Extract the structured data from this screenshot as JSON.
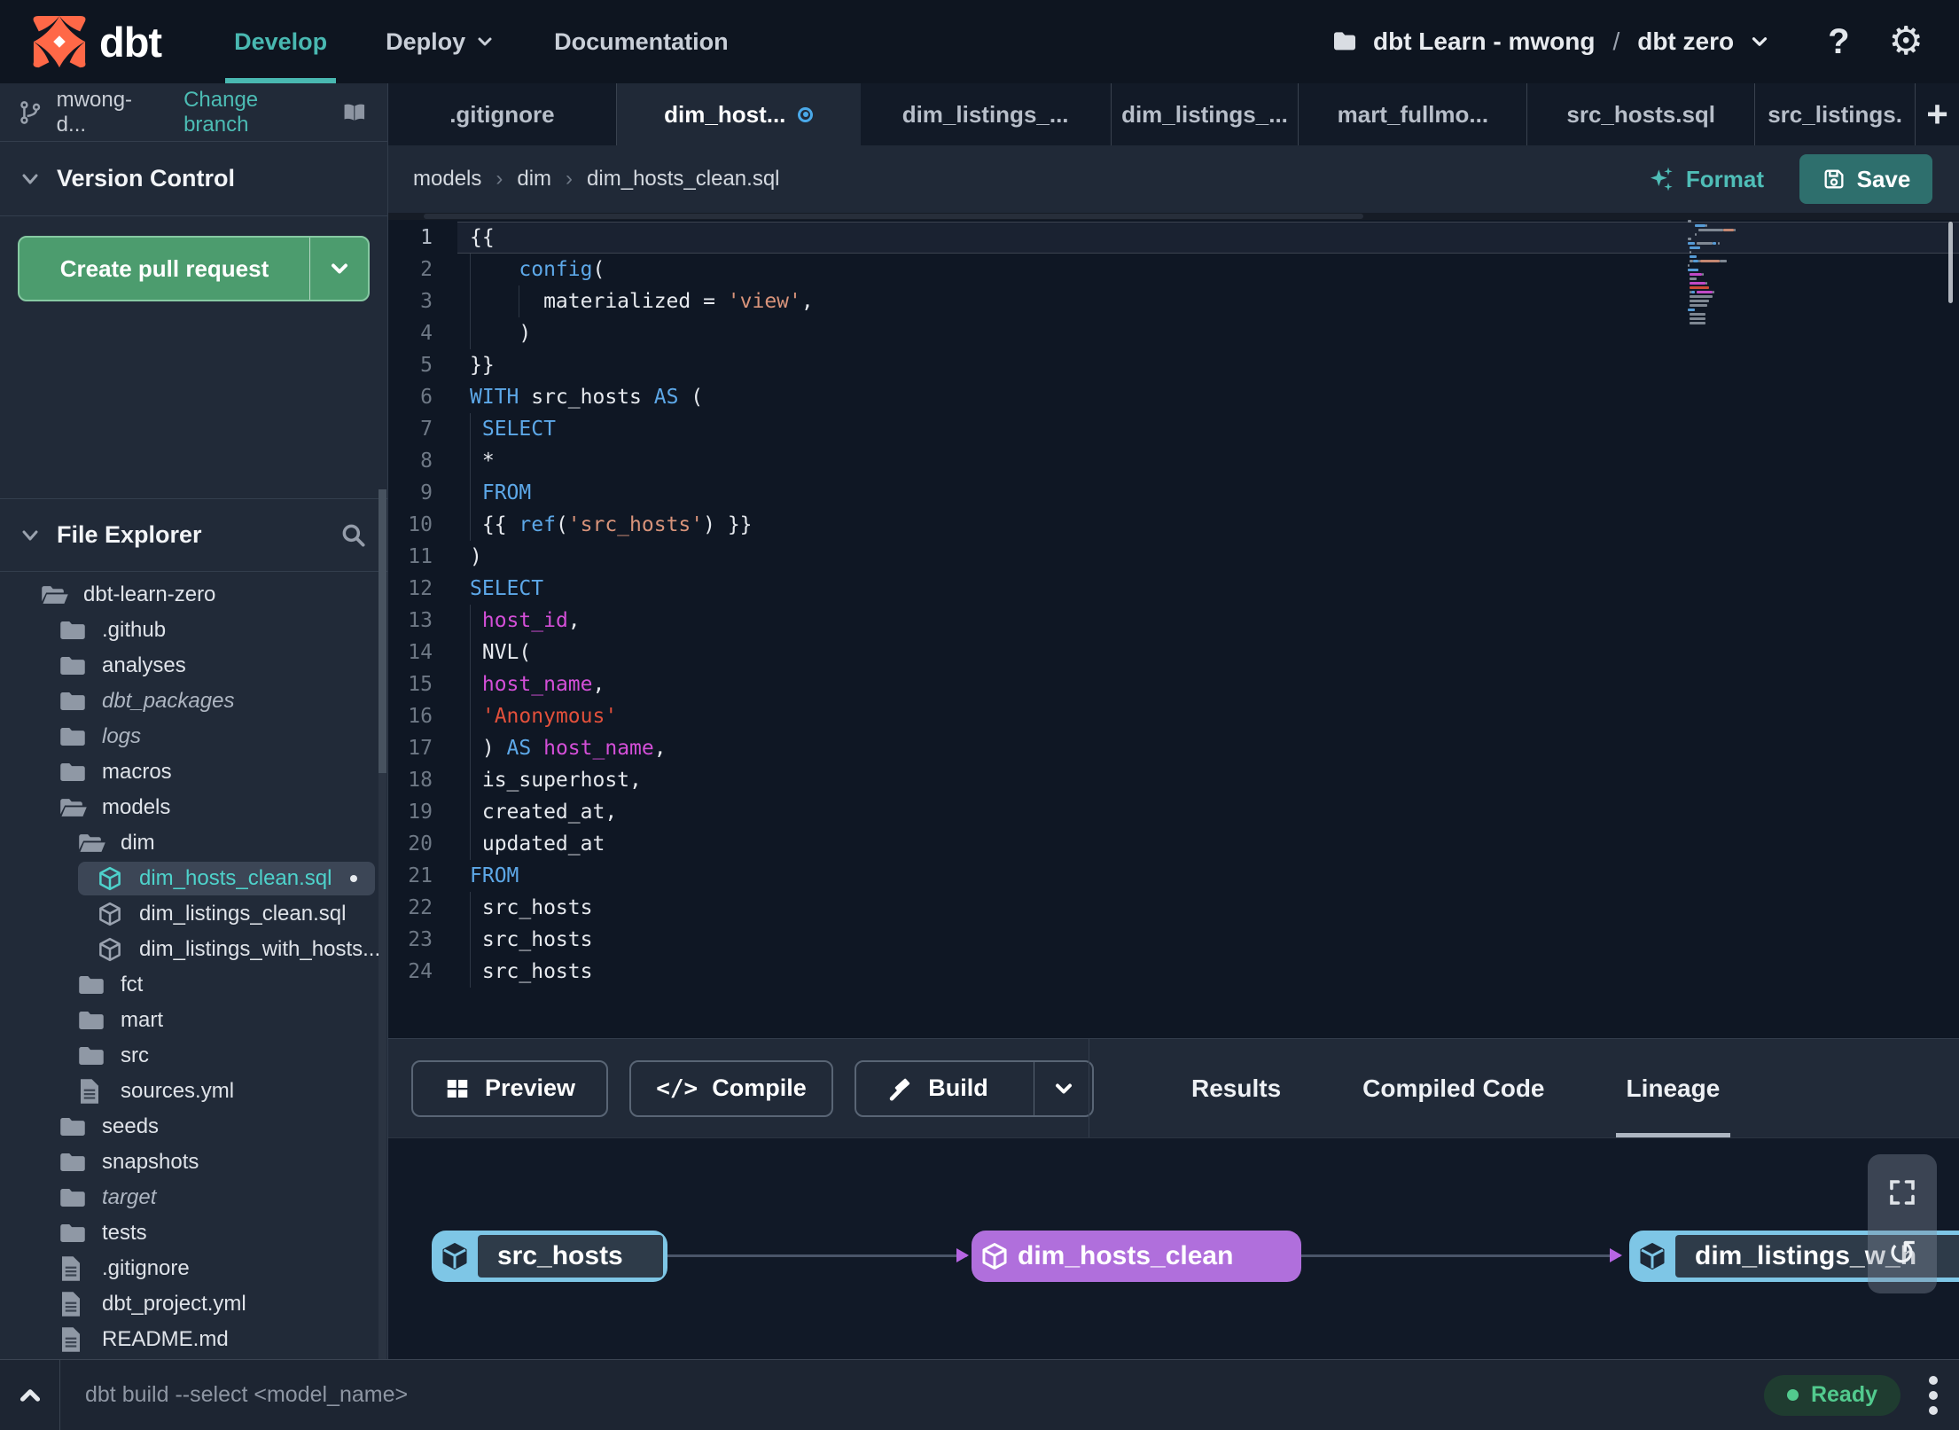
{
  "colors": {
    "accent_teal": "#49b8b1",
    "logo_orange": "#ff6847",
    "pr_green": "#4c9c6e",
    "save_teal": "#2e6f6d",
    "tab_modified_blue": "#4aa9e9",
    "lineage_blue": "#7ec6e6",
    "lineage_purple": "#b06fdc",
    "ready_green": "#52ca8e",
    "keyword_blue": "#5da8e8",
    "string_orange": "#d8937a",
    "string_red": "#e2503b",
    "ident_magenta": "#d44fd8"
  },
  "topbar": {
    "logo_text": "dbt",
    "nav": [
      {
        "label": "Develop"
      },
      {
        "label": "Deploy"
      },
      {
        "label": "Documentation"
      }
    ],
    "project": {
      "account": "dbt Learn - mwong",
      "separator": "/",
      "name": "dbt zero"
    }
  },
  "sidebar": {
    "branch": {
      "name": "mwong-d...",
      "change_link": "Change branch"
    },
    "version_control_title": "Version Control",
    "create_pr_label": "Create pull request",
    "file_explorer_title": "File Explorer",
    "tree": [
      {
        "label": "dbt-learn-zero",
        "type": "folder-open",
        "depth": 0
      },
      {
        "label": ".github",
        "type": "folder",
        "depth": 1
      },
      {
        "label": "analyses",
        "type": "folder",
        "depth": 1
      },
      {
        "label": "dbt_packages",
        "type": "folder",
        "depth": 1,
        "italic": true
      },
      {
        "label": "logs",
        "type": "folder",
        "depth": 1,
        "italic": true
      },
      {
        "label": "macros",
        "type": "folder",
        "depth": 1
      },
      {
        "label": "models",
        "type": "folder-open",
        "depth": 1
      },
      {
        "label": "dim",
        "type": "folder-open",
        "depth": 2
      },
      {
        "label": "dim_hosts_clean.sql",
        "type": "model",
        "depth": 3,
        "selected": true,
        "modified": true
      },
      {
        "label": "dim_listings_clean.sql",
        "type": "model",
        "depth": 3
      },
      {
        "label": "dim_listings_with_hosts...",
        "type": "model",
        "depth": 3
      },
      {
        "label": "fct",
        "type": "folder",
        "depth": 2
      },
      {
        "label": "mart",
        "type": "folder",
        "depth": 2
      },
      {
        "label": "src",
        "type": "folder",
        "depth": 2
      },
      {
        "label": "sources.yml",
        "type": "file",
        "depth": 2
      },
      {
        "label": "seeds",
        "type": "folder",
        "depth": 1
      },
      {
        "label": "snapshots",
        "type": "folder",
        "depth": 1
      },
      {
        "label": "target",
        "type": "folder",
        "depth": 1,
        "italic": true
      },
      {
        "label": "tests",
        "type": "folder",
        "depth": 1
      },
      {
        "label": ".gitignore",
        "type": "file",
        "depth": 1
      },
      {
        "label": "dbt_project.yml",
        "type": "file",
        "depth": 1
      },
      {
        "label": "README.md",
        "type": "file",
        "depth": 1
      }
    ]
  },
  "tabs": {
    "items": [
      {
        "label": ".gitignore"
      },
      {
        "label": "dim_host...",
        "active": true,
        "modified": true
      },
      {
        "label": "dim_listings_..."
      },
      {
        "label": "dim_listings_..."
      },
      {
        "label": "mart_fullmo..."
      },
      {
        "label": "src_hosts.sql"
      },
      {
        "label": "src_listings."
      }
    ],
    "add_button": "+"
  },
  "editorbar": {
    "breadcrumb": [
      "models",
      "dim",
      "dim_hosts_clean.sql"
    ],
    "format_label": "Format",
    "save_label": "Save"
  },
  "editor": {
    "lines": [
      {
        "n": 1,
        "cur": true,
        "t": [
          [
            "w",
            "{{"
          ]
        ]
      },
      {
        "n": 2,
        "g": [
          0
        ],
        "t": [
          [
            "w",
            "    "
          ],
          [
            "k",
            "config"
          ],
          [
            "w",
            "("
          ]
        ]
      },
      {
        "n": 3,
        "g": [
          0,
          4
        ],
        "t": [
          [
            "w",
            "      materialized = "
          ],
          [
            "s1",
            "'view'"
          ],
          [
            "w",
            ","
          ]
        ]
      },
      {
        "n": 4,
        "g": [
          0
        ],
        "t": [
          [
            "w",
            "    )"
          ]
        ]
      },
      {
        "n": 5,
        "t": [
          [
            "w",
            "}}"
          ]
        ]
      },
      {
        "n": 6,
        "t": [
          [
            "k",
            "WITH"
          ],
          [
            "w",
            " src_hosts "
          ],
          [
            "k",
            "AS"
          ],
          [
            "w",
            " ("
          ]
        ]
      },
      {
        "n": 7,
        "g": [
          0
        ],
        "t": [
          [
            "w",
            " "
          ],
          [
            "k",
            "SELECT"
          ]
        ]
      },
      {
        "n": 8,
        "g": [
          0
        ],
        "t": [
          [
            "w",
            " *"
          ]
        ]
      },
      {
        "n": 9,
        "g": [
          0
        ],
        "t": [
          [
            "w",
            " "
          ],
          [
            "k",
            "FROM"
          ]
        ]
      },
      {
        "n": 10,
        "g": [
          0
        ],
        "t": [
          [
            "w",
            " {{ "
          ],
          [
            "k",
            "ref"
          ],
          [
            "w",
            "("
          ],
          [
            "s1",
            "'src_hosts'"
          ],
          [
            "w",
            ") }}"
          ]
        ]
      },
      {
        "n": 11,
        "t": [
          [
            "w",
            ")"
          ]
        ]
      },
      {
        "n": 12,
        "t": [
          [
            "k",
            "SELECT"
          ]
        ]
      },
      {
        "n": 13,
        "g": [
          0
        ],
        "t": [
          [
            "w",
            " "
          ],
          [
            "m",
            "host_id"
          ],
          [
            "w",
            ","
          ]
        ]
      },
      {
        "n": 14,
        "g": [
          0
        ],
        "t": [
          [
            "w",
            " NVL("
          ]
        ]
      },
      {
        "n": 15,
        "g": [
          0
        ],
        "t": [
          [
            "w",
            " "
          ],
          [
            "m",
            "host_name"
          ],
          [
            "w",
            ","
          ]
        ]
      },
      {
        "n": 16,
        "g": [
          0
        ],
        "t": [
          [
            "w",
            " "
          ],
          [
            "s2",
            "'Anonymous'"
          ]
        ]
      },
      {
        "n": 17,
        "g": [
          0
        ],
        "t": [
          [
            "w",
            " ) "
          ],
          [
            "k",
            "AS"
          ],
          [
            "w",
            " "
          ],
          [
            "m",
            "host_name"
          ],
          [
            "w",
            ","
          ]
        ]
      },
      {
        "n": 18,
        "g": [
          0
        ],
        "t": [
          [
            "w",
            " is_superhost,"
          ]
        ]
      },
      {
        "n": 19,
        "g": [
          0
        ],
        "t": [
          [
            "w",
            " created_at,"
          ]
        ]
      },
      {
        "n": 20,
        "g": [
          0
        ],
        "t": [
          [
            "w",
            " updated_at"
          ]
        ]
      },
      {
        "n": 21,
        "t": [
          [
            "k",
            "FROM"
          ]
        ]
      },
      {
        "n": 22,
        "g": [
          0
        ],
        "t": [
          [
            "w",
            " src_hosts"
          ]
        ]
      },
      {
        "n": 23,
        "g": [
          0
        ],
        "t": [
          [
            "w",
            " src_hosts"
          ]
        ]
      },
      {
        "n": 24,
        "g": [
          0
        ],
        "t": [
          [
            "w",
            " src_hosts"
          ]
        ]
      }
    ]
  },
  "panel": {
    "preview_label": "Preview",
    "compile_label": "Compile",
    "compile_icon": "</>",
    "build_label": "Build",
    "tabs": [
      {
        "label": "Results"
      },
      {
        "label": "Compiled Code"
      },
      {
        "label": "Lineage",
        "active": true
      }
    ]
  },
  "lineage": {
    "nodes": [
      {
        "label": "src_hosts",
        "style": "blue"
      },
      {
        "label": "dim_hosts_clean",
        "style": "purple"
      },
      {
        "label": "dim_listings_w_h",
        "style": "blue"
      }
    ]
  },
  "statusbar": {
    "command": "dbt build --select <model_name>",
    "status_label": "Ready",
    "refresh_icon": "↺"
  }
}
